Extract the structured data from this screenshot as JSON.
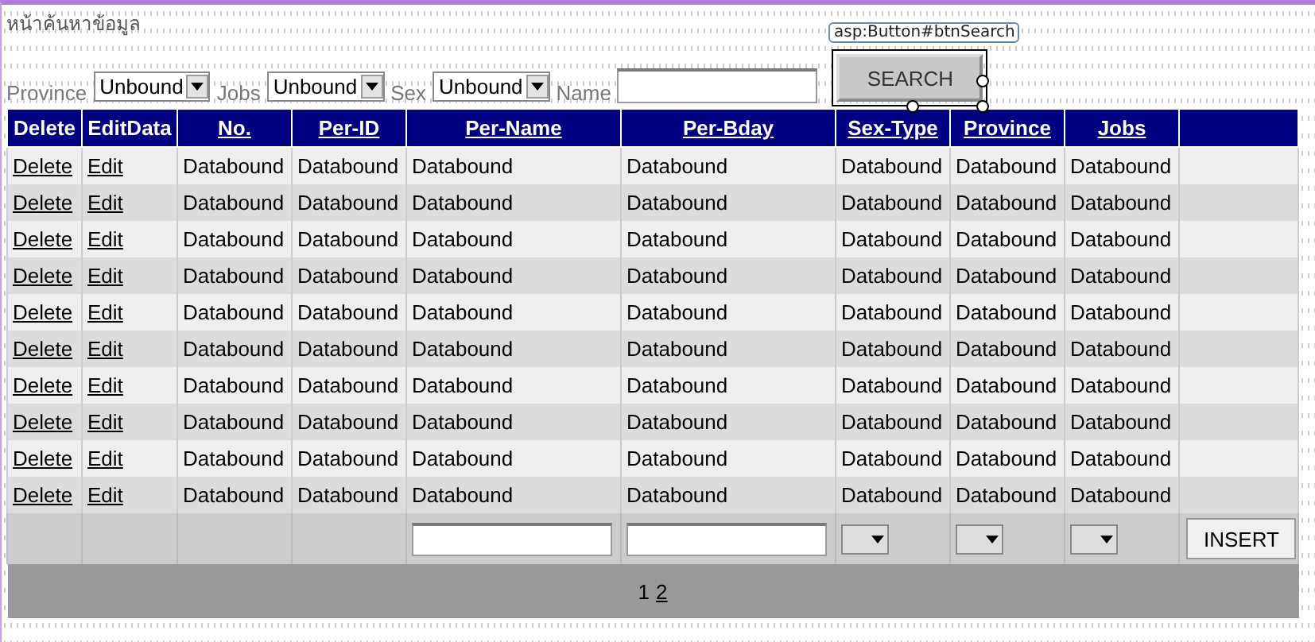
{
  "page_title": "หน้าค้นหาข้อมูล",
  "filters": [
    {
      "label": "Province",
      "value": "Unbound"
    },
    {
      "label": "Jobs",
      "value": "Unbound"
    },
    {
      "label": "Sex",
      "value": "Unbound"
    }
  ],
  "name_filter": {
    "label": "Name"
  },
  "search_button": {
    "label": "SEARCH",
    "designer_tag": "asp:Button#btnSearch",
    "selected": true
  },
  "table": {
    "columns": [
      {
        "label": "Delete",
        "sortable": false
      },
      {
        "label": "EditData",
        "sortable": false
      },
      {
        "label": "No.",
        "sortable": true
      },
      {
        "label": "Per-ID",
        "sortable": true
      },
      {
        "label": "Per-Name",
        "sortable": true
      },
      {
        "label": "Per-Bday",
        "sortable": true
      },
      {
        "label": "Sex-Type",
        "sortable": true
      },
      {
        "label": "Province",
        "sortable": true
      },
      {
        "label": "Jobs",
        "sortable": true
      }
    ],
    "rows": [
      {
        "cells": [
          "Delete",
          "Edit",
          "Databound",
          "Databound",
          "Databound",
          "Databound",
          "Databound",
          "Databound",
          "Databound"
        ]
      },
      {
        "cells": [
          "Delete",
          "Edit",
          "Databound",
          "Databound",
          "Databound",
          "Databound",
          "Databound",
          "Databound",
          "Databound"
        ]
      },
      {
        "cells": [
          "Delete",
          "Edit",
          "Databound",
          "Databound",
          "Databound",
          "Databound",
          "Databound",
          "Databound",
          "Databound"
        ]
      },
      {
        "cells": [
          "Delete",
          "Edit",
          "Databound",
          "Databound",
          "Databound",
          "Databound",
          "Databound",
          "Databound",
          "Databound"
        ]
      },
      {
        "cells": [
          "Delete",
          "Edit",
          "Databound",
          "Databound",
          "Databound",
          "Databound",
          "Databound",
          "Databound",
          "Databound"
        ]
      },
      {
        "cells": [
          "Delete",
          "Edit",
          "Databound",
          "Databound",
          "Databound",
          "Databound",
          "Databound",
          "Databound",
          "Databound"
        ]
      },
      {
        "cells": [
          "Delete",
          "Edit",
          "Databound",
          "Databound",
          "Databound",
          "Databound",
          "Databound",
          "Databound",
          "Databound"
        ]
      },
      {
        "cells": [
          "Delete",
          "Edit",
          "Databound",
          "Databound",
          "Databound",
          "Databound",
          "Databound",
          "Databound",
          "Databound"
        ]
      },
      {
        "cells": [
          "Delete",
          "Edit",
          "Databound",
          "Databound",
          "Databound",
          "Databound",
          "Databound",
          "Databound",
          "Databound"
        ]
      },
      {
        "cells": [
          "Delete",
          "Edit",
          "Databound",
          "Databound",
          "Databound",
          "Databound",
          "Databound",
          "Databound",
          "Databound"
        ]
      }
    ],
    "insert_row": {
      "button": "INSERT"
    },
    "pager": [
      {
        "label": "1",
        "selected": true
      },
      {
        "label": "2",
        "selected": false
      }
    ]
  }
}
